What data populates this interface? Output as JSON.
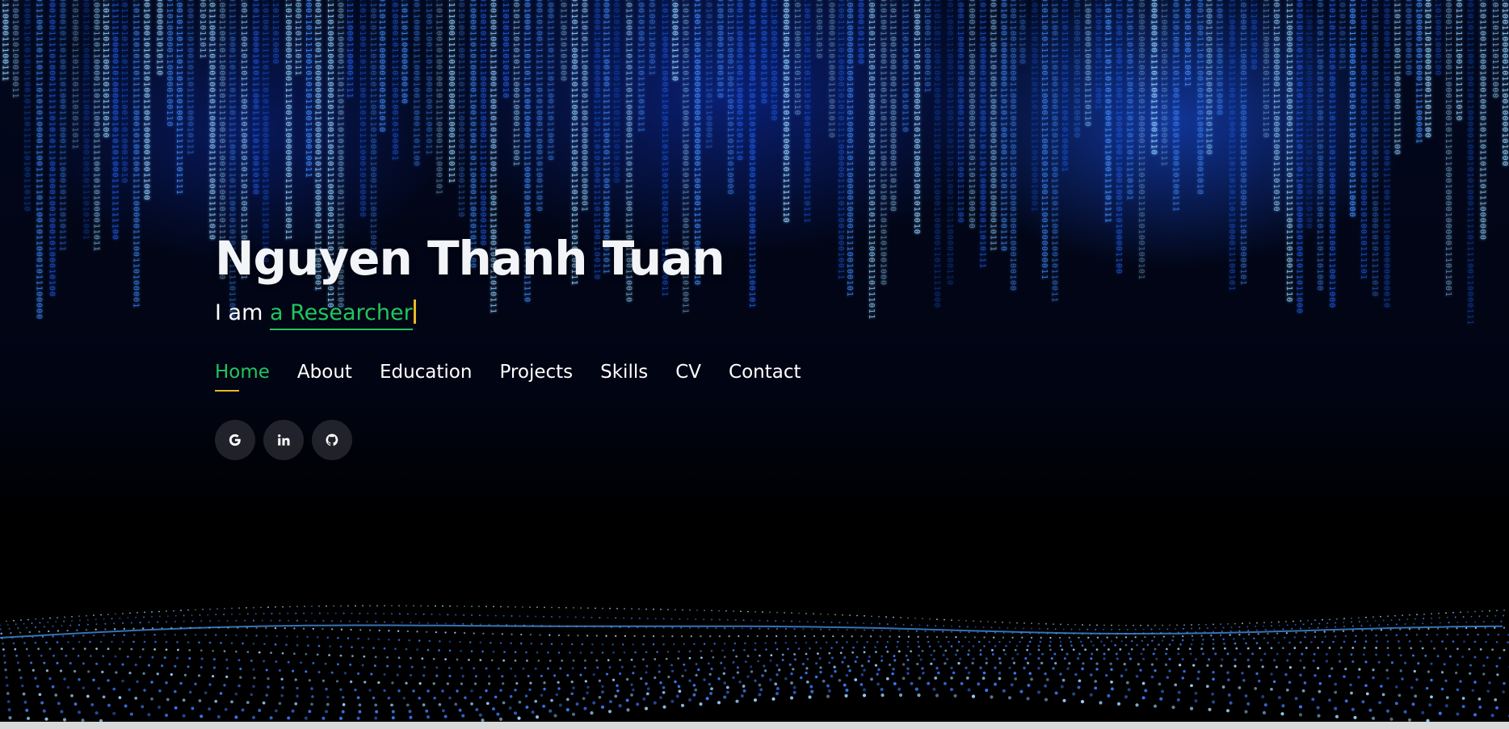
{
  "hero": {
    "name": "Nguyen Thanh Tuan",
    "tagline_prefix": "I am ",
    "tagline_typed": "a Researcher"
  },
  "nav": {
    "items": [
      {
        "label": "Home",
        "active": true
      },
      {
        "label": "About",
        "active": false
      },
      {
        "label": "Education",
        "active": false
      },
      {
        "label": "Projects",
        "active": false
      },
      {
        "label": "Skills",
        "active": false
      },
      {
        "label": "CV",
        "active": false
      },
      {
        "label": "Contact",
        "active": false
      }
    ]
  },
  "socials": [
    {
      "icon": "google-icon"
    },
    {
      "icon": "linkedin-icon"
    },
    {
      "icon": "github-icon"
    }
  ],
  "colors": {
    "accent": "#22c55e",
    "underline": "#e8b923",
    "rain": "#3b82f6",
    "rain_bright": "#7cc4ff",
    "background": "#000000"
  }
}
